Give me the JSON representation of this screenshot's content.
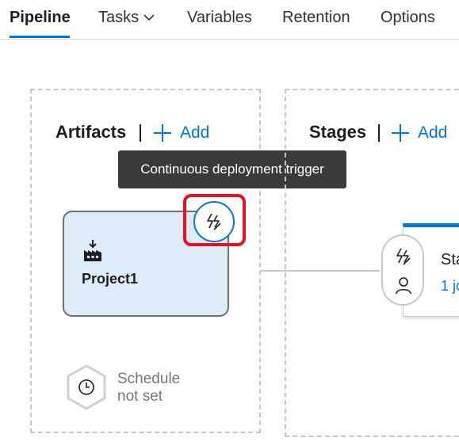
{
  "tabs": {
    "pipeline": "Pipeline",
    "tasks": "Tasks",
    "variables": "Variables",
    "retention": "Retention",
    "options": "Options"
  },
  "artifacts": {
    "heading": "Artifacts",
    "add_label": "Add",
    "card_name": "Project1",
    "tooltip": "Continuous deployment trigger",
    "schedule_line1": "Schedule",
    "schedule_line2": "not set"
  },
  "stages": {
    "heading": "Stages",
    "add_label": "Add",
    "stage_name_partial": "Sta",
    "stage_jobs_partial": "1 jo"
  },
  "colors": {
    "accent": "#0078d4",
    "highlight": "#e81123",
    "card_fill": "#deecf9",
    "tooltip_bg": "#3b3a39"
  },
  "icons": [
    "chevron-down-icon",
    "plus-icon",
    "build-icon",
    "lightning-icon",
    "clock-icon",
    "person-icon"
  ]
}
